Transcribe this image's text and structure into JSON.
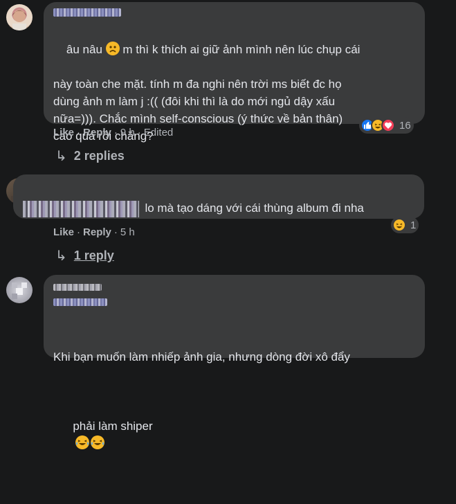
{
  "comments": [
    {
      "author": "",
      "text_line1_a": "âu nâu ",
      "text_line1_b": " m thì k thích ai giữ ảnh mình nên lúc chụp cái",
      "text_rest": "này toàn che mặt. tính m đa nghi nên trời ms biết đc họ\ndùng ảnh m làm j :(( (đôi khi thì là do mới ngủ dậy xấu\nnữa=))). Chắc mình self-conscious (ý thức về bản thân)\ncao quá rồi chăng?",
      "like_label": "Like",
      "reply_label": "Reply",
      "time": "9 h",
      "edited": "Edited",
      "reaction_count": "16",
      "reactions": [
        "like-icon",
        "laugh-icon",
        "love-icon"
      ],
      "replies_label": "2 replies"
    },
    {
      "author": "",
      "text": "lo mà tạo dáng với cái thùng album đi nha",
      "like_label": "Like",
      "reply_label": "Reply",
      "time": "5 h",
      "reaction_count": "1",
      "reactions": [
        "laugh-icon"
      ],
      "replies_label": "1 reply"
    },
    {
      "author": "",
      "text_line1": "Khi bạn muốn làm nhiếp ảnh gia, nhưng dòng đời xô đẩy",
      "text_line2": "phải làm shiper",
      "trailing_emoji": [
        "tears-of-joy-icon",
        "tears-of-joy-icon"
      ]
    }
  ],
  "separators": {
    "dot": "·"
  },
  "colors": {
    "bg": "#18191a",
    "bubble": "#3a3b3c",
    "text": "#e4e6eb",
    "meta": "#b0b3b8",
    "like": "#1877f2",
    "love": "#f33e58",
    "haha": "#f7b928"
  }
}
